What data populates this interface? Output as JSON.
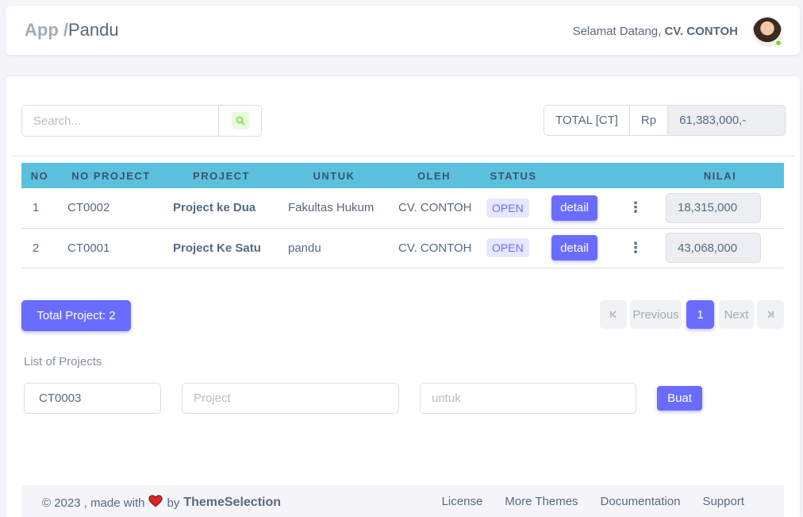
{
  "navbar": {
    "crumb_root": "App /",
    "crumb_current": "Pandu",
    "welcome_text": "Selamat Datang,",
    "welcome_user": "CV. CONTOH"
  },
  "toolbar": {
    "search_placeholder": "Search...",
    "total_label": "TOTAL [CT]",
    "currency": "Rp",
    "total_value": "61,383,000,-"
  },
  "table": {
    "headers": [
      "NO",
      "NO PROJECT",
      "PROJECT",
      "UNTUK",
      "OLEH",
      "STATUS",
      "",
      "",
      "NILAI"
    ],
    "rows": [
      {
        "no": "1",
        "no_project": "CT0002",
        "project": "Project ke Dua",
        "untuk": "Fakultas Hukum",
        "oleh": "CV. CONTOH",
        "status": "OPEN",
        "action": "detail",
        "nilai": "18,315,000"
      },
      {
        "no": "2",
        "no_project": "CT0001",
        "project": "Project Ke Satu",
        "untuk": "pandu",
        "oleh": "CV. CONTOH",
        "status": "OPEN",
        "action": "detail",
        "nilai": "43,068,000"
      }
    ]
  },
  "summary": {
    "total_projects": "Total Project: 2"
  },
  "pagination": {
    "previous": "Previous",
    "current": "1",
    "next": "Next"
  },
  "form": {
    "title": "List of Projects",
    "no_project_value": "CT0003",
    "project_placeholder": "Project",
    "untuk_placeholder": "untuk",
    "submit_label": "Buat"
  },
  "footer": {
    "copyright": "© 2023 , made with",
    "by": "by",
    "brand": "ThemeSelection",
    "links": [
      "License",
      "More Themes",
      "Documentation",
      "Support"
    ]
  },
  "colors": {
    "primary": "#696cff",
    "table_header": "#5bc0de",
    "online": "#71dd37"
  }
}
